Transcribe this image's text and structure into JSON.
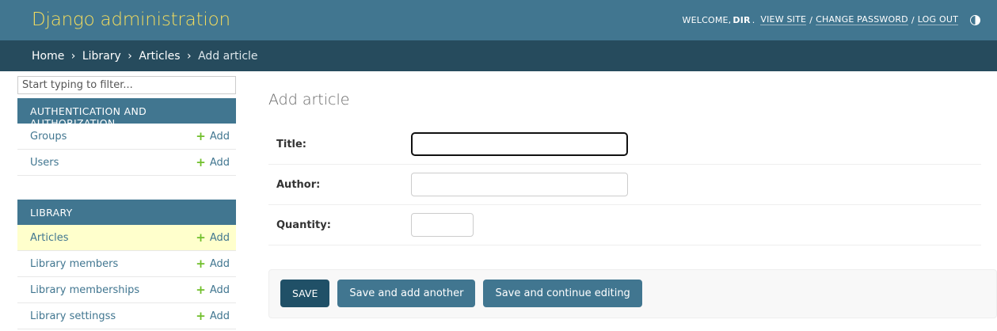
{
  "header": {
    "branding": "Django administration",
    "welcome": "WELCOME,",
    "user_name": "DIR",
    "user_name_suffix": ".",
    "view_site": "VIEW SITE",
    "change_password": "CHANGE PASSWORD",
    "log_out": "LOG OUT",
    "separator": "/"
  },
  "breadcrumbs": {
    "home": "Home",
    "library": "Library",
    "articles": "Articles",
    "current": "Add article",
    "separator": "›"
  },
  "sidebar": {
    "filter_placeholder": "Start typing to filter...",
    "add_label": "Add",
    "apps": [
      {
        "caption": "AUTHENTICATION AND AUTHORIZATION",
        "models": [
          {
            "label": "Groups"
          },
          {
            "label": "Users"
          }
        ]
      },
      {
        "caption": "LIBRARY",
        "models": [
          {
            "label": "Articles",
            "current": true
          },
          {
            "label": "Library members"
          },
          {
            "label": "Library memberships"
          },
          {
            "label": "Library settingss"
          }
        ]
      }
    ]
  },
  "main": {
    "title": "Add article",
    "fields": [
      {
        "label": "Title:",
        "value": ""
      },
      {
        "label": "Author:",
        "value": ""
      },
      {
        "label": "Quantity:",
        "value": ""
      }
    ],
    "buttons": {
      "save": "Save",
      "save_add_another": "Save and add another",
      "save_continue": "Save and continue editing"
    }
  },
  "colors": {
    "header_bg": "#417690",
    "breadcrumb_bg": "#264b5d",
    "branding": "#f5dd5d",
    "current_row_bg": "#ffffcc",
    "add_icon": "#70bf2b"
  }
}
